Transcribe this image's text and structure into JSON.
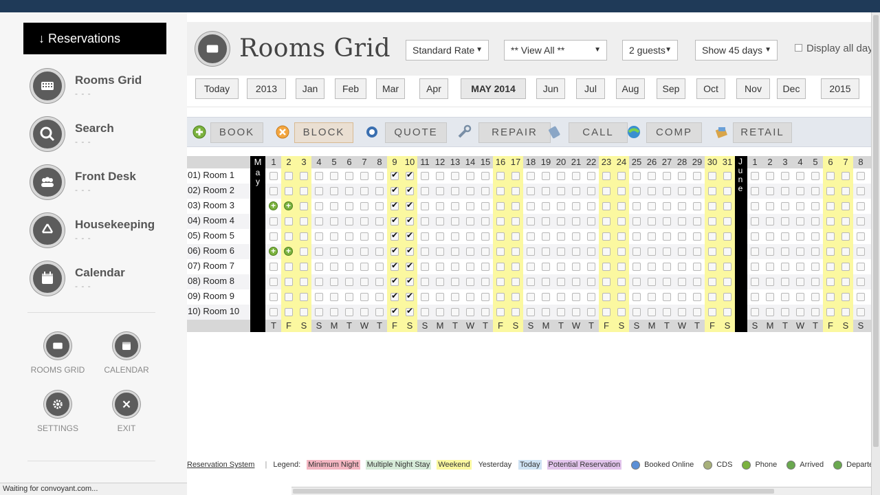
{
  "sidebar": {
    "header": "↓ Reservations",
    "items": [
      {
        "label": "Rooms Grid",
        "sub": "- - -",
        "icon": "grid-icon"
      },
      {
        "label": "Search",
        "sub": "- - -",
        "icon": "search-icon"
      },
      {
        "label": "Front Desk",
        "sub": "- - -",
        "icon": "people-icon"
      },
      {
        "label": "Housekeeping",
        "sub": "- - -",
        "icon": "recycle-icon"
      },
      {
        "label": "Calendar",
        "sub": "- - -",
        "icon": "calendar-icon"
      }
    ],
    "shortcuts": [
      {
        "label": "ROOMS GRID",
        "icon": "grid-icon"
      },
      {
        "label": "CALENDAR",
        "icon": "calendar-icon"
      },
      {
        "label": "SETTINGS",
        "icon": "gear-icon"
      },
      {
        "label": "EXIT",
        "icon": "close-icon"
      }
    ]
  },
  "header": {
    "title": "Rooms Grid",
    "rate_select": "Standard Rate",
    "view_select": "** View All **",
    "guests_select": "2 guests",
    "days_select": "Show 45 days",
    "display_all": "Display all day"
  },
  "month_bar": [
    "Today",
    "2013",
    "Jan",
    "Feb",
    "Mar",
    "Apr",
    "MAY 2014",
    "Jun",
    "Jul",
    "Aug",
    "Sep",
    "Oct",
    "Nov",
    "Dec",
    "2015"
  ],
  "current_month": "MAY 2014",
  "actions": [
    "BOOK",
    "BLOCK",
    "QUOTE",
    "REPAIR",
    "CALL",
    "COMP",
    "RETAIL"
  ],
  "active_action": "BLOCK",
  "grid": {
    "month1": "May",
    "month2": "June",
    "days1": [
      "1",
      "2",
      "3",
      "4",
      "5",
      "6",
      "7",
      "8",
      "9",
      "10",
      "11",
      "12",
      "13",
      "14",
      "15",
      "16",
      "17",
      "18",
      "19",
      "20",
      "21",
      "22",
      "23",
      "24",
      "25",
      "26",
      "27",
      "28",
      "29",
      "30",
      "31"
    ],
    "dow1": [
      "T",
      "F",
      "S",
      "S",
      "M",
      "T",
      "W",
      "T",
      "F",
      "S",
      "S",
      "M",
      "T",
      "W",
      "T",
      "F",
      "S",
      "S",
      "M",
      "T",
      "W",
      "T",
      "F",
      "S",
      "S",
      "M",
      "T",
      "W",
      "T",
      "F",
      "S"
    ],
    "days2": [
      "1",
      "2",
      "3",
      "4",
      "5",
      "6",
      "7",
      "8"
    ],
    "dow2": [
      "S",
      "M",
      "T",
      "W",
      "T",
      "F",
      "S",
      "S"
    ],
    "weekend1": [
      1,
      2,
      8,
      9,
      15,
      16,
      22,
      23,
      29,
      30
    ],
    "weekend2": [
      5,
      6
    ],
    "rooms": [
      "01) Room 1",
      "02) Room 2",
      "03) Room 3",
      "04) Room 4",
      "05) Room 5",
      "06) Room 6",
      "07) Room 7",
      "08) Room 8",
      "09) Room 9",
      "10) Room 10"
    ],
    "checked_days": [
      8,
      9
    ],
    "plus_rooms": [
      2,
      5
    ],
    "plus_days": [
      0,
      1
    ]
  },
  "footer": {
    "system": "Reservation System",
    "sep": "|",
    "legend_label": "Legend:",
    "legend": [
      {
        "text": "Minimum Night",
        "color": "#f4b6c2"
      },
      {
        "text": "Multiple Night Stay",
        "color": "#d7ecd9"
      },
      {
        "text": "Weekend",
        "color": "#fbf8a0"
      },
      {
        "text": "Yesterday",
        "color": ""
      },
      {
        "text": "Today",
        "color": "#cfe3f4"
      },
      {
        "text": "Potential Reservation",
        "color": "#e2c4ec"
      }
    ],
    "icons": [
      {
        "text": "Booked Online",
        "color": "#5b8fd6"
      },
      {
        "text": "CDS",
        "color": "#a7b07a"
      },
      {
        "text": "Phone",
        "color": "#7bb23f"
      },
      {
        "text": "Arrived",
        "color": "#6aa84f"
      },
      {
        "text": "Departed",
        "color": "#6aa84f"
      }
    ]
  },
  "status_text": "Waiting for convoyant.com..."
}
